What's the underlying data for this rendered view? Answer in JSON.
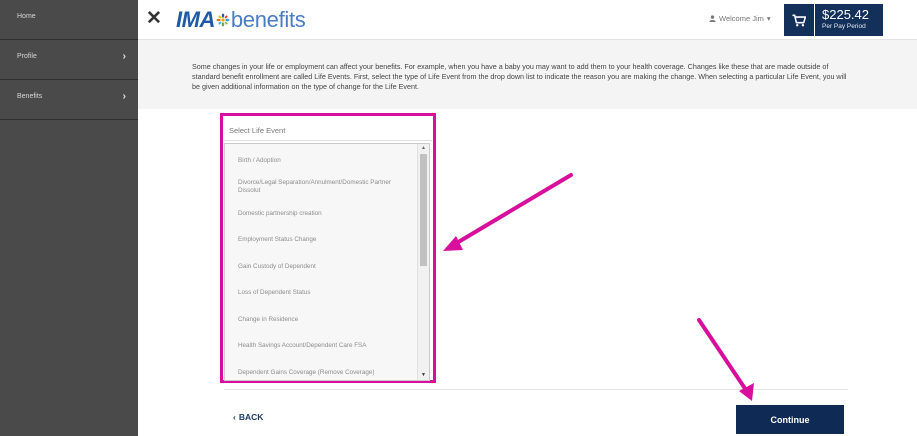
{
  "sidebar": {
    "items": [
      {
        "label": "Home",
        "has_chevron": false
      },
      {
        "label": "Profile",
        "has_chevron": true
      },
      {
        "label": "Benefits",
        "has_chevron": true
      }
    ],
    "chevron_glyph": "›"
  },
  "header": {
    "close_glyph": "✕",
    "logo_brand": "IMA",
    "logo_product": "benefits",
    "welcome_text": "Welcome Jim",
    "welcome_caret": "▾",
    "cart_icon": "shopping-cart-icon",
    "price_amount": "$225.42",
    "price_period": "Per Pay Period"
  },
  "intro": {
    "text": "Some changes in your life or employment can affect your benefits. For example, when you have a baby you may want to add them to your health coverage. Changes like these that are made outside of standard benefit enrollment are called Life Events. First, select the type of Life Event from the drop down list to indicate the reason you are making the change. When selecting a particular Life Event, you will be given additional information on the type of change for the Life Event."
  },
  "life_event_select": {
    "placeholder": "Select Life Event",
    "options": [
      "Birth / Adoption",
      "Divorce/Legal Separation/Annulment/Domestic Partner Dissolut",
      "Domestic partnership creation",
      "Employment Status Change",
      "Gain Custody of Dependent",
      "Loss of Dependent Status",
      "Change in Residence",
      "Health Savings Account/Dependent Care FSA",
      "Dependent Gains Coverage (Remove Coverage)"
    ]
  },
  "footer": {
    "back_label": "BACK",
    "back_glyph": "‹",
    "continue_label": "Continue"
  },
  "colors": {
    "sidebar_bg": "#4a4a4a",
    "brand_navy": "#12305a",
    "annotation_magenta": "#d80f9c",
    "logo_blue": "#1e5aa6"
  }
}
